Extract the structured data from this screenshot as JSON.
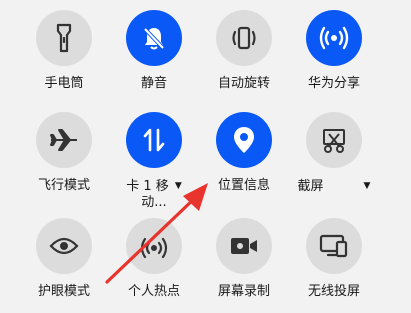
{
  "tiles": {
    "flashlight": {
      "label": "手电筒",
      "icon": "flashlight-icon",
      "state": "off"
    },
    "mute": {
      "label": "静音",
      "icon": "bell-off-icon",
      "state": "on"
    },
    "auto_rotate": {
      "label": "自动旋转",
      "icon": "rotate-icon",
      "state": "off"
    },
    "huawei_share": {
      "label": "华为分享",
      "icon": "share-wave-icon",
      "state": "on"
    },
    "airplane": {
      "label": "飞行模式",
      "icon": "airplane-icon",
      "state": "off"
    },
    "mobile_data": {
      "label_line1": "卡 1 移",
      "label_line2": "动...",
      "caret": "▼",
      "icon": "mobile-data-icon",
      "state": "on"
    },
    "location": {
      "label": "位置信息",
      "icon": "location-pin-icon",
      "state": "on"
    },
    "screenshot": {
      "label": "截屏",
      "caret": "▼",
      "icon": "scissors-icon",
      "state": "off"
    },
    "eye_comfort": {
      "label": "护眼模式",
      "icon": "eye-icon",
      "state": "off"
    },
    "hotspot": {
      "label": "个人热点",
      "icon": "hotspot-icon",
      "state": "off"
    },
    "screen_record": {
      "label": "屏幕录制",
      "icon": "video-camera-icon",
      "state": "off"
    },
    "wireless_projection": {
      "label": "无线投屏",
      "icon": "cast-icon",
      "state": "off"
    }
  },
  "colors": {
    "accent": "#0a59f7",
    "tile_off": "#dcdcdc",
    "icon_dark": "#333333",
    "annotation_arrow": "#e8342c"
  }
}
